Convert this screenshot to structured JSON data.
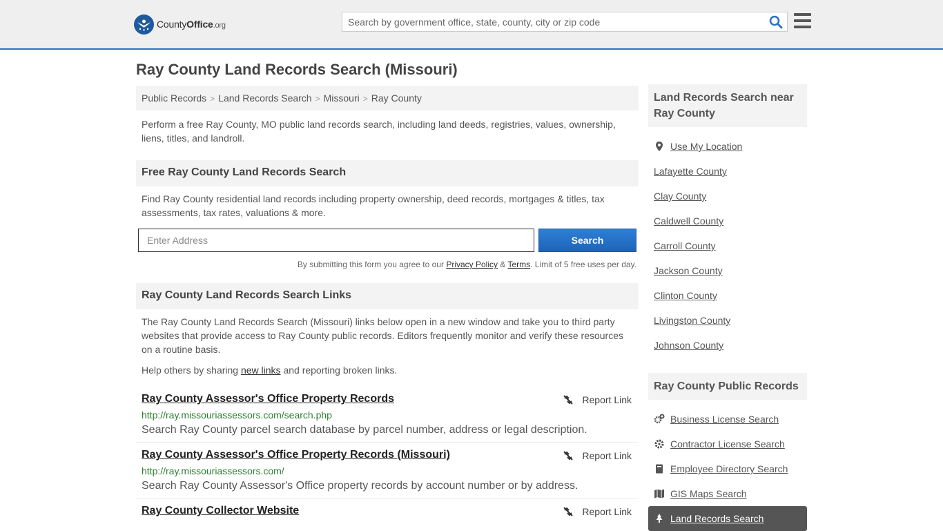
{
  "header": {
    "logo_main": "County",
    "logo_bold": "Office",
    "logo_tld": ".org",
    "search_placeholder": "Search by government office, state, county, city or zip code"
  },
  "page_title": "Ray County Land Records Search (Missouri)",
  "breadcrumb": [
    "Public Records",
    "Land Records Search",
    "Missouri",
    "Ray County"
  ],
  "intro": "Perform a free Ray County, MO public land records search, including land deeds, registries, values, ownership, liens, titles, and landroll.",
  "free_search": {
    "heading": "Free Ray County Land Records Search",
    "text": "Find Ray County residential land records including property ownership, deed records, mortgages & titles, tax assessments, tax rates, valuations & more.",
    "input_placeholder": "Enter Address",
    "button": "Search",
    "terms_prefix": "By submitting this form you agree to our ",
    "privacy": "Privacy Policy",
    "amp": " & ",
    "terms": "Terms",
    "terms_suffix": ". Limit of 5 free uses per day."
  },
  "links_section": {
    "heading": "Ray County Land Records Search Links",
    "text": "The Ray County Land Records Search (Missouri) links below open in a new window and take you to third party websites that provide access to Ray County public records. Editors frequently monitor and verify these resources on a routine basis.",
    "help_prefix": "Help others by sharing ",
    "help_link": "new links",
    "help_suffix": " and reporting broken links.",
    "report_label": "Report Link",
    "items": [
      {
        "title": "Ray County Assessor's Office Property Records",
        "url": "http://ray.missouriassessors.com/search.php",
        "desc": "Search Ray County parcel search database by parcel number, address or legal description."
      },
      {
        "title": "Ray County Assessor's Office Property Records (Missouri)",
        "url": "http://ray.missouriassessors.com/",
        "desc": "Search Ray County Assessor's Office property records by account number or by address."
      },
      {
        "title": "Ray County Collector Website",
        "url": "",
        "desc": ""
      }
    ]
  },
  "sidebar": {
    "nearby_heading": "Land Records Search near Ray County",
    "use_location": "Use My Location",
    "nearby": [
      "Lafayette County",
      "Clay County",
      "Caldwell County",
      "Carroll County",
      "Jackson County",
      "Clinton County",
      "Livingston County",
      "Johnson County"
    ],
    "public_heading": "Ray County Public Records",
    "public": [
      {
        "label": "Business License Search",
        "icon": "gears-icon"
      },
      {
        "label": "Contractor License Search",
        "icon": "gear-icon"
      },
      {
        "label": "Employee Directory Search",
        "icon": "book-icon"
      },
      {
        "label": "GIS Maps Search",
        "icon": "map-icon"
      },
      {
        "label": "Land Records Search",
        "icon": "tree-icon",
        "active": true
      }
    ]
  },
  "colors": {
    "accent": "#2a73c5",
    "url_green": "#2e7d32",
    "active_bg": "#555555"
  }
}
